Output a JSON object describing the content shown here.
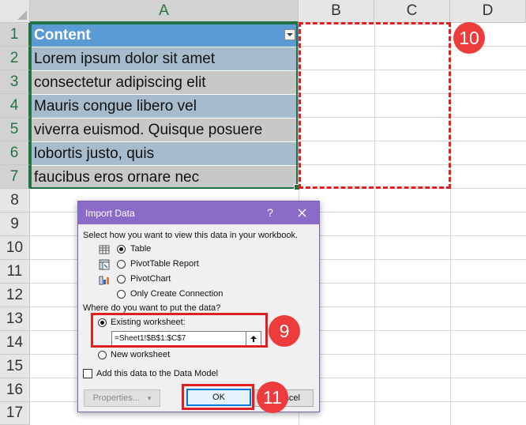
{
  "columns": [
    "A",
    "B",
    "C",
    "D"
  ],
  "rows": [
    "1",
    "2",
    "3",
    "4",
    "5",
    "6",
    "7",
    "8",
    "9",
    "10",
    "11",
    "12",
    "13",
    "14",
    "15",
    "16",
    "17"
  ],
  "table": {
    "header": "Content",
    "cells": [
      "Lorem ipsum dolor sit amet",
      "consectetur adipiscing elit",
      "Mauris congue libero vel",
      "viverra euismod. Quisque posuere",
      "lobortis justo, quis",
      "faucibus eros ornare nec"
    ]
  },
  "badges": {
    "b10": "10",
    "b9": "9",
    "b11": "11"
  },
  "dialog": {
    "title": "Import Data",
    "help": "?",
    "close": "✕",
    "prompt_view": "Select how you want to view this data in your workbook.",
    "options": {
      "table": "Table",
      "pivot_table": "PivotTable Report",
      "pivot_chart": "PivotChart",
      "only_connection": "Only Create Connection"
    },
    "prompt_location": "Where do you want to put the data?",
    "existing_worksheet": "Existing worksheet:",
    "range_value": "=Sheet1!$B$1:$C$7",
    "new_worksheet": "New worksheet",
    "data_model": "Add this data to the Data Model",
    "properties_button": "Properties...",
    "ok_button": "OK",
    "cancel_button": "ncel"
  },
  "colors": {
    "accent": "#217346",
    "title_bar": "#8a6cc8",
    "annotation": "#e02020",
    "table_header": "#5b9bd5"
  },
  "icons": [
    "table-icon",
    "pivottable-icon",
    "pivotchart-icon",
    "collapse-arrow-icon",
    "close-icon"
  ]
}
